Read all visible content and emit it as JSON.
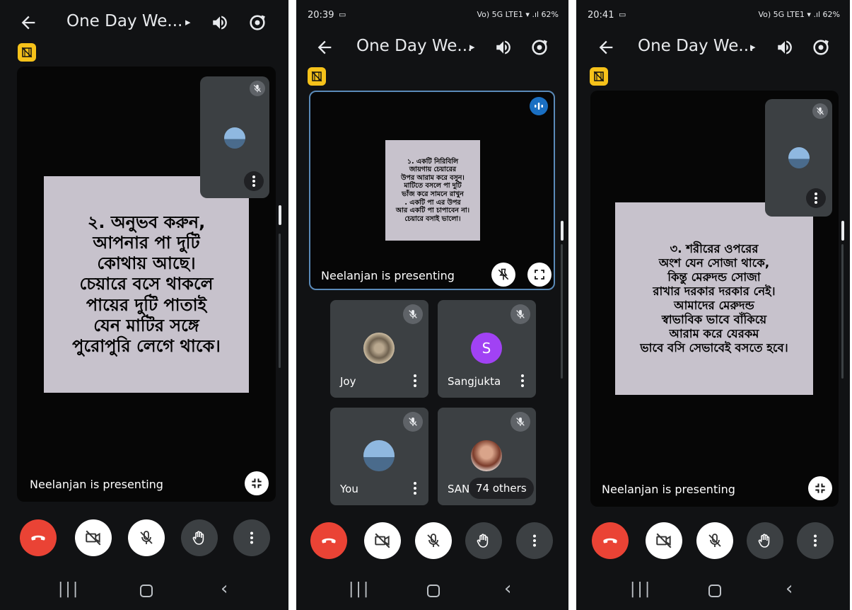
{
  "meeting": {
    "title": "One Day We...",
    "caret": "▸"
  },
  "panels": [
    {
      "status": null,
      "slide_text": "২. অনুভব করুন,\nআপনার পা দুটি\nকোথায় আছে।\nচেয়ারে বসে থাকলে\nপায়ের দুটি পাতাই\nযেন মাটির সঙ্গে\nপুরোপুরি লেগে থাকে।",
      "presenting": "Neelanjan is presenting"
    },
    {
      "status": {
        "time": "20:39",
        "signal": "Vo) 5G LTE1 ▾ .ıl 62%"
      },
      "slide_text": "১. একটি নিরিবিলি\nজায়গায় চেয়ারের\nউপর আরাম করে বসুন।\nমাটিতে বসলে পা দুটি\nভাঁজ করে সামনে রাখুন\n. একটি পা এর উপর\nআর একটি পা চাপাবেন না।\nচেয়ারে বসাই ভালো।",
      "presenting": "Neelanjan is presenting",
      "tiles": [
        {
          "name": "Joy"
        },
        {
          "name": "Sangjukta",
          "initial": "S"
        },
        {
          "name": "You"
        },
        {
          "name": "SANG"
        }
      ],
      "others": "74 others"
    },
    {
      "status": {
        "time": "20:41",
        "signal": "Vo) 5G LTE1 ▾ .ıl 62%"
      },
      "slide_text": "৩. শরীরের ওপরের\nঅংশ যেন সোজা থাকে,\nকিন্তু মেরুদন্ড সোজা\nরাখার দরকার দরকার নেই।\nআমাদের মেরুদন্ড\nস্বাভাবিক ভাবে বাঁকিয়ে\nআরাম করে যেরকম\nভাবে বসি সেভাবেই বসতে হবে।",
      "presenting": "Neelanjan is presenting"
    }
  ],
  "colors": {
    "hangup": "#ea4335",
    "badge": "#f6c21a",
    "avatar_s": "#a142f4",
    "accent_border": "#1a73e8"
  }
}
